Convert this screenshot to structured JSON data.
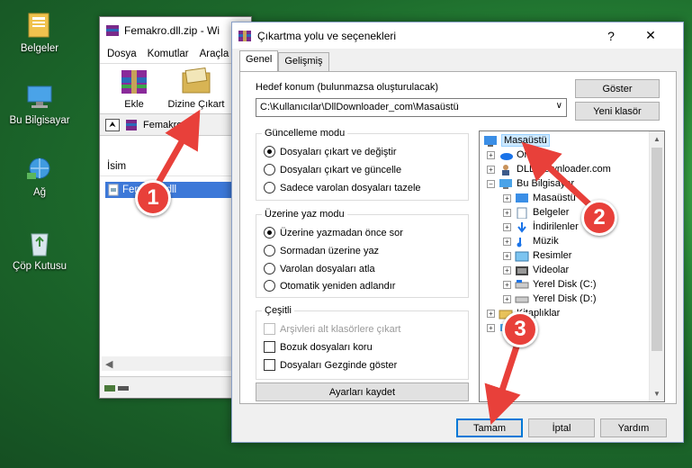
{
  "desktop": {
    "icons": [
      {
        "label": "Belgeler",
        "icon": "documents-folder-icon"
      },
      {
        "label": "Bu Bilgisayar",
        "icon": "computer-icon"
      },
      {
        "label": "Ağ",
        "icon": "network-icon"
      },
      {
        "label": "Çöp Kutusu",
        "icon": "recycle-bin-icon"
      }
    ]
  },
  "winrar": {
    "title": "Femakro.dll.zip - Wi",
    "menu": [
      "Dosya",
      "Komutlar",
      "Araçla"
    ],
    "toolbar": {
      "ekle": "Ekle",
      "dizine_cikart": "Dizine Çıkart"
    },
    "path": "Femakro.dll",
    "column": "İsim",
    "file": "Femakro.dll"
  },
  "dialog": {
    "title": "Çıkartma yolu ve seçenekleri",
    "help_btn": "?",
    "close_btn": "✕",
    "tabs": {
      "genel": "Genel",
      "gelismis": "Gelişmiş"
    },
    "target_label": "Hedef konum (bulunmazsa oluşturulacak)",
    "target_value": "C:\\Kullanıcılar\\DllDownloader_com\\Masaüstü",
    "btn_goster": "Göster",
    "btn_yeni_klasor": "Yeni klasör",
    "update_group": {
      "title": "Güncelleme modu",
      "options": [
        "Dosyaları çıkart ve değiştir",
        "Dosyaları çıkart ve güncelle",
        "Sadece varolan dosyaları tazele"
      ],
      "selected": 0
    },
    "overwrite_group": {
      "title": "Üzerine yaz modu",
      "options": [
        "Üzerine yazmadan önce sor",
        "Sormadan üzerine yaz",
        "Varolan dosyaları atla",
        "Otomatik yeniden adlandır"
      ],
      "selected": 0
    },
    "misc_group": {
      "title": "Çeşitli",
      "options": [
        "Arşivleri alt klasörlere çıkart",
        "Bozuk dosyaları koru",
        "Dosyaları Gezginde göster"
      ],
      "disabled": [
        true,
        false,
        false
      ]
    },
    "btn_save_settings": "Ayarları kaydet",
    "tree": {
      "items": [
        {
          "label": "Masaüstü",
          "icon": "desktop-icon"
        },
        {
          "label": "OneDrive",
          "icon": "onedrive-icon"
        },
        {
          "label": "DLL Downloader.com",
          "icon": "user-icon"
        },
        {
          "label": "Bu Bilgisayar",
          "icon": "computer-icon"
        },
        {
          "label": "Masaüstü",
          "icon": "desktop-icon"
        },
        {
          "label": "Belgeler",
          "icon": "documents-icon"
        },
        {
          "label": "İndirilenler",
          "icon": "downloads-icon"
        },
        {
          "label": "Müzik",
          "icon": "music-icon"
        },
        {
          "label": "Resimler",
          "icon": "pictures-icon"
        },
        {
          "label": "Videolar",
          "icon": "videos-icon"
        },
        {
          "label": "Yerel Disk (C:)",
          "icon": "drive-icon"
        },
        {
          "label": "Yerel Disk (D:)",
          "icon": "drive-icon"
        },
        {
          "label": "Kitaplıklar",
          "icon": "libraries-icon"
        },
        {
          "label": "Ağ",
          "icon": "network-icon"
        }
      ]
    },
    "btn_ok": "Tamam",
    "btn_cancel": "İptal",
    "btn_help": "Yardım"
  },
  "annotations": [
    "1",
    "2",
    "3"
  ],
  "colors": {
    "badge": "#e8403a",
    "selection": "#3c78d8",
    "accent": "#0078d7"
  }
}
